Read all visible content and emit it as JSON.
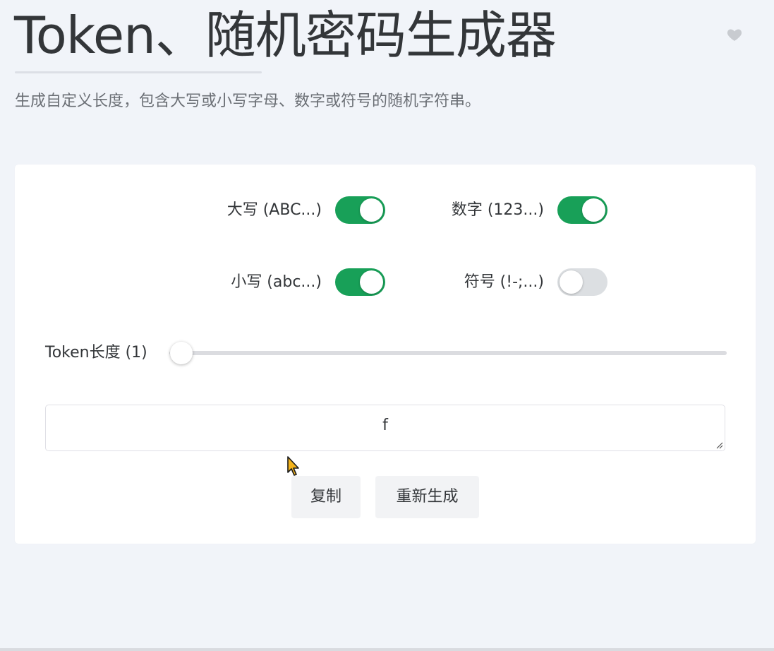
{
  "header": {
    "title": "Token、随机密码生成器",
    "subtitle": "生成自定义长度，包含大写或小写字母、数字或符号的随机字符串。",
    "favorite_icon": "heart-icon"
  },
  "options": {
    "uppercase": {
      "label": "大写 (ABC...)",
      "checked": true
    },
    "numbers": {
      "label": "数字 (123...)",
      "checked": true
    },
    "lowercase": {
      "label": "小写 (abc...)",
      "checked": true
    },
    "symbols": {
      "label": "符号 (!-;...)",
      "checked": false
    }
  },
  "length": {
    "label": "Token长度 (1)",
    "value": 1,
    "min": 1,
    "max": 512
  },
  "output": {
    "value": "f"
  },
  "buttons": {
    "copy": "复制",
    "refresh": "重新生成"
  },
  "colors": {
    "accent": "#18a058",
    "background": "#f1f4f9"
  }
}
